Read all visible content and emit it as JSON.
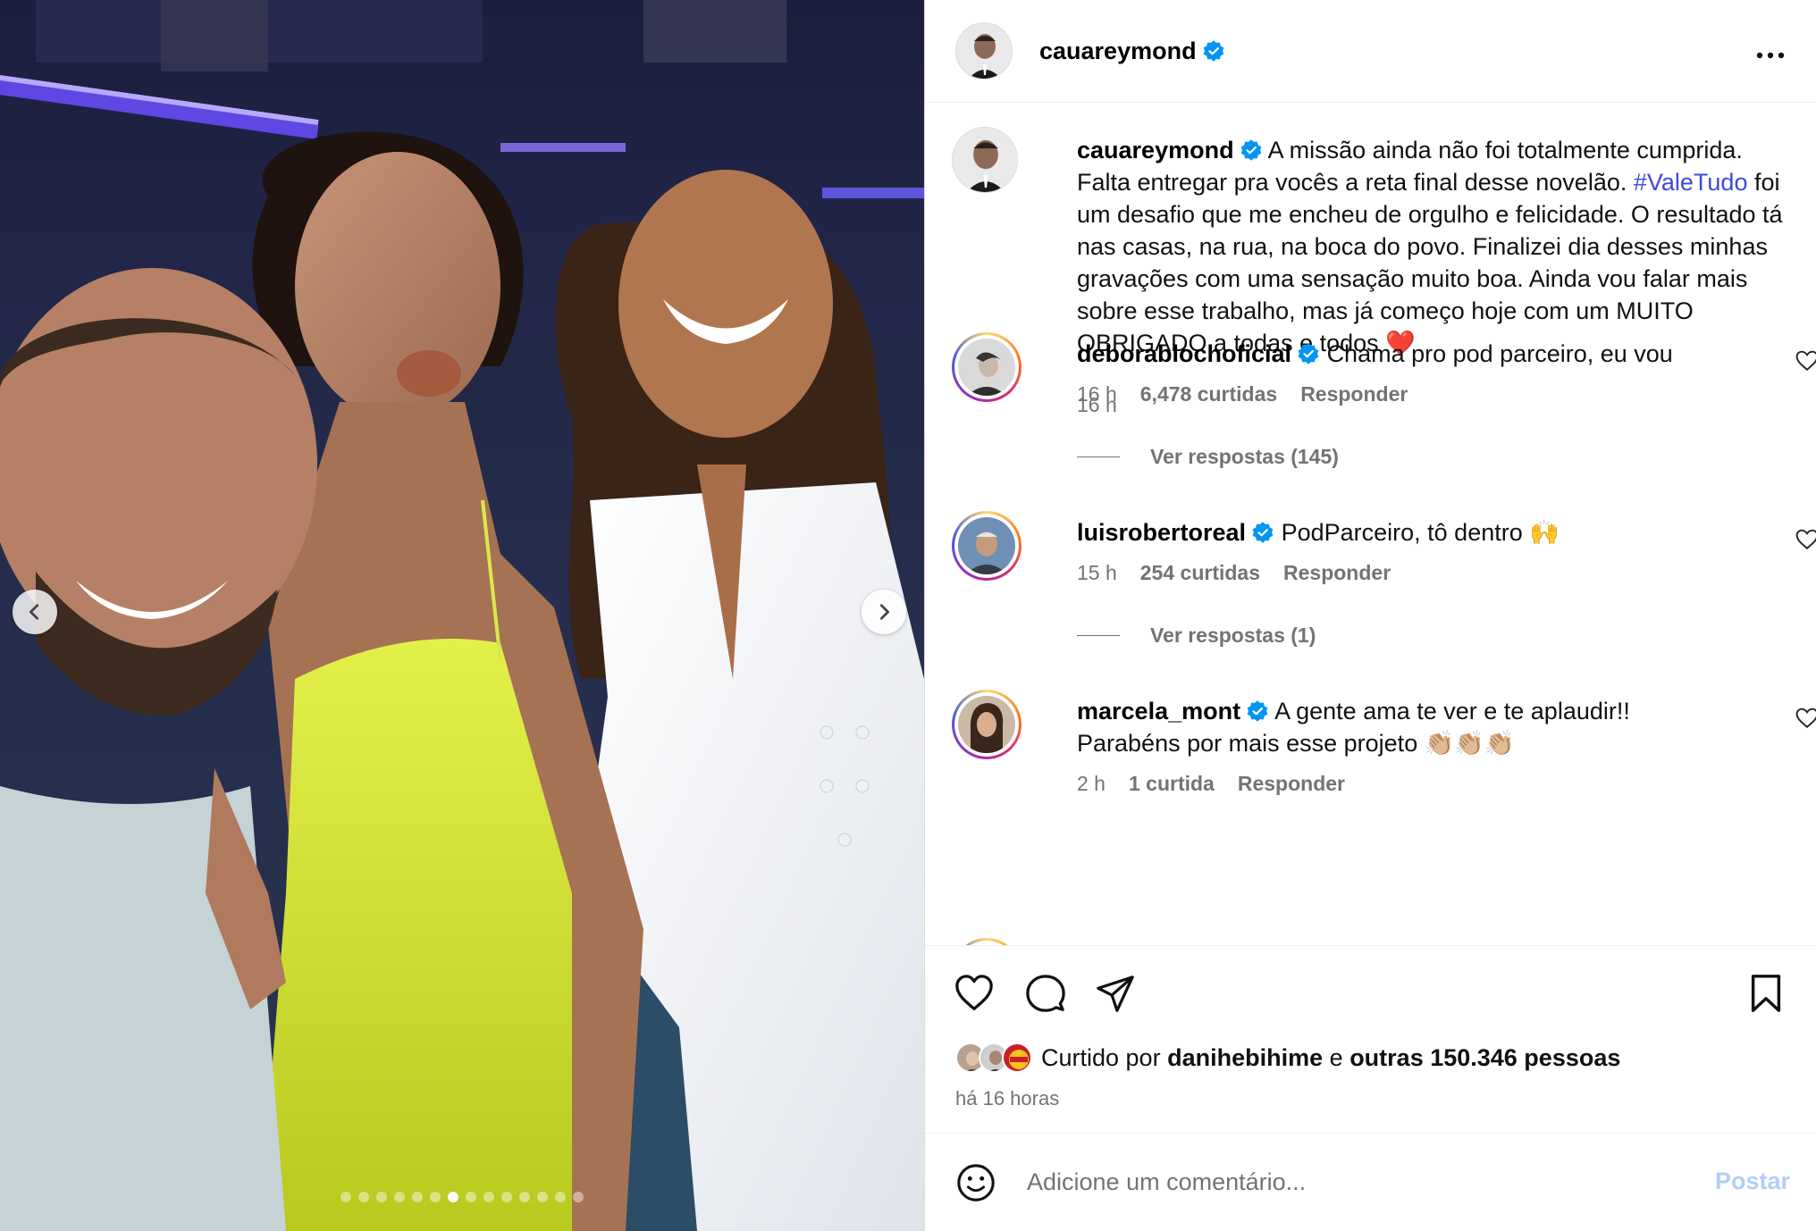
{
  "post": {
    "author": "cauareymond",
    "verified": true,
    "more_icon": "more-horizontal-icon",
    "carousel": {
      "total_slides": 14,
      "active_slide": 6
    }
  },
  "caption": {
    "username": "cauareymond",
    "text_before": "A missão ainda não foi totalmente cumprida. Falta entregar pra vocês a reta final desse novelão.",
    "hashtag": "#ValeTudo",
    "text_after": "foi um desafio que me encheu de orgulho e felicidade. O resultado tá nas casas, na rua, na boca do povo. Finalizei dia desses minhas gravações com uma sensação muito boa. Ainda vou falar mais sobre esse trabalho, mas já começo hoje com um MUITO OBRIGADO a todas e todos ❤️",
    "time": "16 h"
  },
  "comments": [
    {
      "username": "deborablochoficial",
      "text": "Chama pro pod parceiro, eu vou",
      "time": "16 h",
      "likes": "6,478 curtidas",
      "reply": "Responder",
      "view_replies": "Ver respostas (145)"
    },
    {
      "username": "luisrobertoreal",
      "text": "PodParceiro, tô dentro 🙌",
      "time": "15 h",
      "likes": "254 curtidas",
      "reply": "Responder",
      "view_replies": "Ver respostas (1)"
    },
    {
      "username": "marcela_mont",
      "text": "A gente ama te ver e te aplaudir!! Parabéns por mais esse projeto 👏🏼👏🏼👏🏼",
      "time": "2 h",
      "likes": "1 curtida",
      "reply": "Responder"
    }
  ],
  "likes": {
    "prefix": "Curtido por",
    "user": "danihebihime",
    "conj": "e",
    "others": "outras 150.346 pessoas",
    "ago": "há 16 horas"
  },
  "composer": {
    "placeholder": "Adicione um comentário...",
    "post_label": "Postar"
  },
  "colors": {
    "verified": "#0095f6",
    "hashtag": "#3d4bd6",
    "secondary_text": "#737373",
    "post_button": "#b3cdf8"
  }
}
